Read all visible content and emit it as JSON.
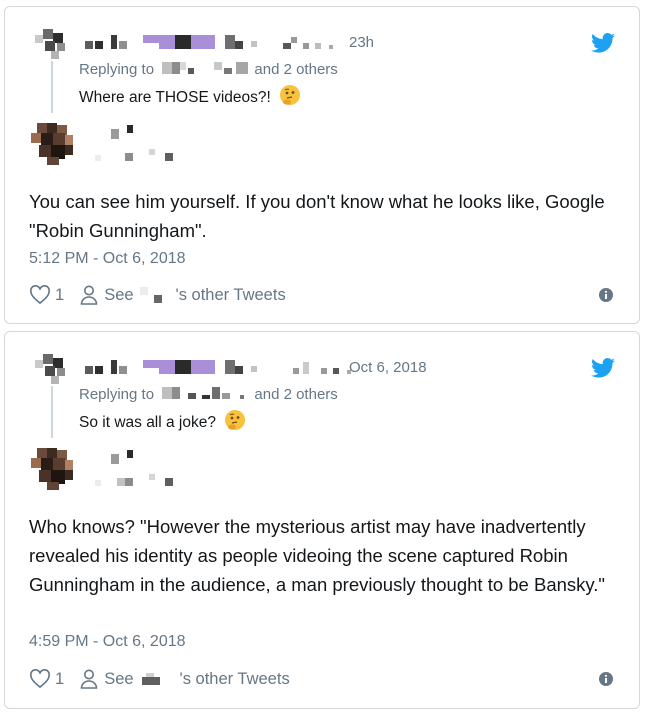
{
  "tweets": [
    {
      "parent": {
        "time": "23h",
        "replying_prefix": "Replying to",
        "replying_suffix": "and 2 others",
        "text": "Where are THOSE videos?!",
        "emoji": "thinking-face-emoji"
      },
      "reply": {
        "text": "You can see him yourself. If you don't know what he looks like, Google \"Robin Gunningham\".",
        "timestamp": "5:12 PM - Oct 6, 2018",
        "like_count": "1",
        "see_label": "See",
        "other_tweets_label": "'s other Tweets"
      }
    },
    {
      "parent": {
        "time": "Oct 6, 2018",
        "replying_prefix": "Replying to",
        "replying_suffix": "and 2 others",
        "text": "So it was all a joke?",
        "emoji": "thinking-face-emoji"
      },
      "reply": {
        "text": "Who knows? \"However the mysterious artist may have inadvertently revealed his identity as people videoing the scene captured Robin Gunningham in the audience, a man previously thought to be Bansky.\"",
        "timestamp": "4:59 PM - Oct 6, 2018",
        "like_count": "1",
        "see_label": "See",
        "other_tweets_label": "'s other Tweets"
      }
    }
  ],
  "colors": {
    "twitter_blue": "#1da1f2",
    "secondary_text": "#657786",
    "primary_text": "#14171a",
    "border": "#d3d8dd",
    "redaction_purple": "#a98fd8"
  },
  "icons": [
    "twitter-bird-icon",
    "heart-icon",
    "person-icon",
    "info-icon",
    "thinking-face-emoji"
  ]
}
